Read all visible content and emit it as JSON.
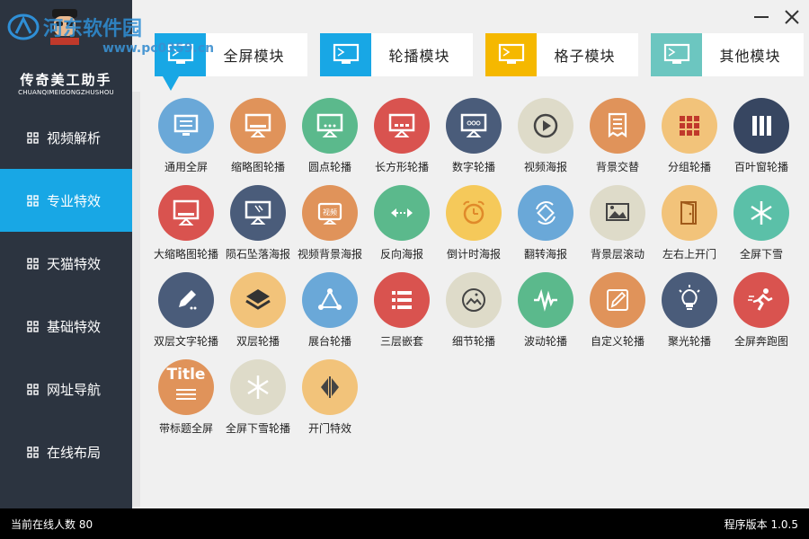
{
  "app": {
    "title": "传奇美工助手",
    "subtitle": "CHUANQIMEIGONGZHUSHOU"
  },
  "watermark": {
    "text": "河东软件园",
    "url": "www.pc0359.cn"
  },
  "nav": [
    {
      "label": "视频解析"
    },
    {
      "label": "专业特效",
      "active": true
    },
    {
      "label": "天猫特效"
    },
    {
      "label": "基础特效"
    },
    {
      "label": "网址导航"
    },
    {
      "label": "在线布局"
    }
  ],
  "tabs": [
    {
      "label": "全屏模块",
      "icon_color": "#18a7e5"
    },
    {
      "label": "轮播模块",
      "icon_color": "#18a7e5"
    },
    {
      "label": "格子模块",
      "icon_color": "#f5b800"
    },
    {
      "label": "其他模块",
      "icon_color": "#6cc6c0"
    }
  ],
  "items": [
    {
      "label": "通用全屏",
      "color": "#6aa8d8",
      "icon": "monitor-icon"
    },
    {
      "label": "缩略图轮播",
      "color": "#e0935a",
      "icon": "monitor-thumbnail-icon"
    },
    {
      "label": "圆点轮播",
      "color": "#5bb98c",
      "icon": "monitor-dots-icon"
    },
    {
      "label": "长方形轮播",
      "color": "#d9534f",
      "icon": "monitor-rect-icon"
    },
    {
      "label": "数字轮播",
      "color": "#4a5c7a",
      "icon": "monitor-number-icon"
    },
    {
      "label": "视频海报",
      "color": "#dedbc9",
      "icon": "play-icon"
    },
    {
      "label": "背景交替",
      "color": "#e0935a",
      "icon": "document-icon"
    },
    {
      "label": "分组轮播",
      "color": "#f2c37a",
      "icon": "grid-icon"
    },
    {
      "label": "百叶窗轮播",
      "color": "#374661",
      "icon": "blinds-icon"
    },
    {
      "label": "大缩略图轮播",
      "color": "#d9534f",
      "icon": "monitor-large-icon"
    },
    {
      "label": "陨石坠落海报",
      "color": "#4a5c7a",
      "icon": "meteor-icon"
    },
    {
      "label": "视频背景海报",
      "color": "#e0935a",
      "icon": "video-icon"
    },
    {
      "label": "反向海报",
      "color": "#5bb98c",
      "icon": "arrows-icon"
    },
    {
      "label": "倒计时海报",
      "color": "#f5c95a",
      "icon": "alarm-clock-icon"
    },
    {
      "label": "翻转海报",
      "color": "#6aa8d8",
      "icon": "rotate-icon"
    },
    {
      "label": "背景层滚动",
      "color": "#dedbc9",
      "icon": "picture-icon"
    },
    {
      "label": "左右上开门",
      "color": "#f2c37a",
      "icon": "door-icon"
    },
    {
      "label": "全屏下雪",
      "color": "#5bc0a8",
      "icon": "snowflake-icon"
    },
    {
      "label": "双层文字轮播",
      "color": "#4a5c7a",
      "icon": "pencil-icon"
    },
    {
      "label": "双层轮播",
      "color": "#f2c37a",
      "icon": "layers-icon"
    },
    {
      "label": "展台轮播",
      "color": "#6aa8d8",
      "icon": "share-icon"
    },
    {
      "label": "三层嵌套",
      "color": "#d9534f",
      "icon": "list-icon"
    },
    {
      "label": "细节轮播",
      "color": "#dedbc9",
      "icon": "image-icon"
    },
    {
      "label": "波动轮播",
      "color": "#5bb98c",
      "icon": "wave-icon"
    },
    {
      "label": "自定义轮播",
      "color": "#e0935a",
      "icon": "edit-icon"
    },
    {
      "label": "聚光轮播",
      "color": "#4a5c7a",
      "icon": "bulb-icon"
    },
    {
      "label": "全屏奔跑图",
      "color": "#d9534f",
      "icon": "runner-icon"
    },
    {
      "label": "带标题全屏",
      "color": "#e0935a",
      "icon": "title-icon",
      "text": "Title"
    },
    {
      "label": "全屏下雪轮播",
      "color": "#dedbc9",
      "icon": "snowflake-icon"
    },
    {
      "label": "开门特效",
      "color": "#f2c37a",
      "icon": "open-door-icon"
    }
  ],
  "status": {
    "online": "当前在线人数 80",
    "version": "程序版本 1.0.5"
  }
}
